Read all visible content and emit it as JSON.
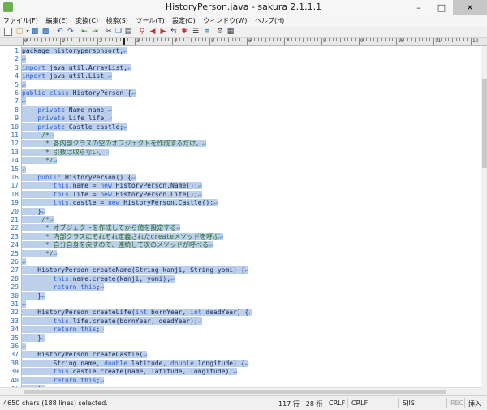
{
  "window": {
    "title": "HistoryPerson.java - sakura 2.1.1.1"
  },
  "menu": [
    "ファイル(F)",
    "編集(E)",
    "変換(C)",
    "検索(S)",
    "ツール(T)",
    "設定(O)",
    "ウィンドウ(W)",
    "ヘルプ(H)"
  ],
  "ruler": {
    "labels": [
      "0",
      "1",
      "2",
      "3",
      "4",
      "5",
      "6",
      "7",
      "8",
      "9",
      "10",
      "11",
      "12",
      "13",
      "14"
    ]
  },
  "lines": [
    {
      "n": "1",
      "segs": [
        [
          "package historypersonsort;",
          "t"
        ],
        [
          "↵",
          "e"
        ]
      ]
    },
    {
      "n": "2",
      "segs": [
        [
          "↵",
          "e"
        ]
      ]
    },
    {
      "n": "3",
      "segs": [
        [
          "import",
          "k"
        ],
        [
          " java.util.ArrayList;",
          "t"
        ],
        [
          "↵",
          "e"
        ]
      ]
    },
    {
      "n": "4",
      "segs": [
        [
          "import",
          "k"
        ],
        [
          " java.util.List;",
          "t"
        ],
        [
          "↵",
          "e"
        ]
      ]
    },
    {
      "n": "5",
      "segs": [
        [
          "↵",
          "e"
        ]
      ]
    },
    {
      "n": "6",
      "segs": [
        [
          "public class",
          "k"
        ],
        [
          " HistoryPerson {",
          "t"
        ],
        [
          "↵",
          "e"
        ]
      ]
    },
    {
      "n": "7",
      "segs": [
        [
          "↵",
          "e"
        ]
      ]
    },
    {
      "n": "8",
      "segs": [
        [
          "    ",
          "t"
        ],
        [
          "private",
          "k"
        ],
        [
          " Name name;",
          "t"
        ],
        [
          "↵",
          "e"
        ]
      ]
    },
    {
      "n": "9",
      "segs": [
        [
          "    ",
          "t"
        ],
        [
          "private",
          "k"
        ],
        [
          " Life life;",
          "t"
        ],
        [
          "↵",
          "e"
        ]
      ]
    },
    {
      "n": "10",
      "segs": [
        [
          "    ",
          "t"
        ],
        [
          "private",
          "k"
        ],
        [
          " Castle castle;",
          "t"
        ],
        [
          "↵",
          "e"
        ]
      ]
    },
    {
      "n": "11",
      "segs": [
        [
          "     /*",
          "c"
        ],
        [
          "↵",
          "e"
        ]
      ]
    },
    {
      "n": "12",
      "segs": [
        [
          "      * 各内部クラスの空のオブジェクトを作成するだけ。",
          "c"
        ],
        [
          "↵",
          "e"
        ]
      ]
    },
    {
      "n": "13",
      "segs": [
        [
          "      * 引数は取らない。",
          "c"
        ],
        [
          "↵",
          "e"
        ]
      ]
    },
    {
      "n": "14",
      "segs": [
        [
          "      */",
          "c"
        ],
        [
          "↵",
          "e"
        ]
      ]
    },
    {
      "n": "15",
      "segs": [
        [
          "↵",
          "e"
        ]
      ]
    },
    {
      "n": "16",
      "segs": [
        [
          "    ",
          "t"
        ],
        [
          "public",
          "k"
        ],
        [
          " HistoryPerson() {",
          "t"
        ],
        [
          "↵",
          "e"
        ]
      ]
    },
    {
      "n": "17",
      "segs": [
        [
          "        ",
          "t"
        ],
        [
          "this",
          "k"
        ],
        [
          ".name = ",
          "t"
        ],
        [
          "new",
          "k"
        ],
        [
          " HistoryPerson.Name();",
          "t"
        ],
        [
          "↵",
          "e"
        ]
      ]
    },
    {
      "n": "18",
      "segs": [
        [
          "        ",
          "t"
        ],
        [
          "this",
          "k"
        ],
        [
          ".life = ",
          "t"
        ],
        [
          "new",
          "k"
        ],
        [
          " HistoryPerson.Life();",
          "t"
        ],
        [
          "↵",
          "e"
        ]
      ]
    },
    {
      "n": "19",
      "segs": [
        [
          "        ",
          "t"
        ],
        [
          "this",
          "k"
        ],
        [
          ".castle = ",
          "t"
        ],
        [
          "new",
          "k"
        ],
        [
          " HistoryPerson.Castle();",
          "t"
        ],
        [
          "↵",
          "e"
        ]
      ]
    },
    {
      "n": "20",
      "segs": [
        [
          "    }",
          "t"
        ],
        [
          "↵",
          "e"
        ]
      ]
    },
    {
      "n": "21",
      "segs": [
        [
          "     /*",
          "c"
        ],
        [
          "↵",
          "e"
        ]
      ]
    },
    {
      "n": "22",
      "segs": [
        [
          "      * オブジェクトを作成してから値を設定する",
          "c"
        ],
        [
          "↵",
          "e"
        ]
      ]
    },
    {
      "n": "23",
      "segs": [
        [
          "      * 内部クラスにそれぞれ定義されたcreateメソッドを呼ぶ",
          "c"
        ],
        [
          "↵",
          "e"
        ]
      ]
    },
    {
      "n": "24",
      "segs": [
        [
          "      * 自分自身を戻すので、連続して次のメソッドが呼べる",
          "c"
        ],
        [
          "↵",
          "e"
        ]
      ]
    },
    {
      "n": "25",
      "segs": [
        [
          "      */",
          "c"
        ],
        [
          "↵",
          "e"
        ]
      ]
    },
    {
      "n": "26",
      "segs": [
        [
          "↵",
          "e"
        ]
      ]
    },
    {
      "n": "27",
      "segs": [
        [
          "    HistoryPerson createName(String kanji, String yomi) {",
          "t"
        ],
        [
          "↵",
          "e"
        ]
      ]
    },
    {
      "n": "28",
      "segs": [
        [
          "        ",
          "t"
        ],
        [
          "this",
          "k"
        ],
        [
          ".name.create(kanji, yomi);",
          "t"
        ],
        [
          "↵",
          "e"
        ]
      ]
    },
    {
      "n": "29",
      "segs": [
        [
          "        ",
          "t"
        ],
        [
          "return this",
          "k"
        ],
        [
          ";",
          "t"
        ],
        [
          "↵",
          "e"
        ]
      ]
    },
    {
      "n": "30",
      "segs": [
        [
          "    }",
          "t"
        ],
        [
          "↵",
          "e"
        ]
      ]
    },
    {
      "n": "31",
      "segs": [
        [
          "↵",
          "e"
        ]
      ]
    },
    {
      "n": "32",
      "segs": [
        [
          "    HistoryPerson createLife(",
          "t"
        ],
        [
          "int",
          "k"
        ],
        [
          " bornYear, ",
          "t"
        ],
        [
          "int",
          "k"
        ],
        [
          " deadYear) {",
          "t"
        ],
        [
          "↵",
          "e"
        ]
      ]
    },
    {
      "n": "33",
      "segs": [
        [
          "        ",
          "t"
        ],
        [
          "this",
          "k"
        ],
        [
          ".life.create(bornYear, deadYear);",
          "t"
        ],
        [
          "↵",
          "e"
        ]
      ]
    },
    {
      "n": "34",
      "segs": [
        [
          "        ",
          "t"
        ],
        [
          "return this",
          "k"
        ],
        [
          ";",
          "t"
        ],
        [
          "↵",
          "e"
        ]
      ]
    },
    {
      "n": "35",
      "segs": [
        [
          "    }",
          "t"
        ],
        [
          "↵",
          "e"
        ]
      ]
    },
    {
      "n": "36",
      "segs": [
        [
          "↵",
          "e"
        ]
      ]
    },
    {
      "n": "37",
      "segs": [
        [
          "    HistoryPerson createCastle(",
          "t"
        ],
        [
          "↵",
          "e"
        ]
      ]
    },
    {
      "n": "38",
      "segs": [
        [
          "        String name, ",
          "t"
        ],
        [
          "double",
          "k"
        ],
        [
          " latitude, ",
          "t"
        ],
        [
          "double",
          "k"
        ],
        [
          " longitude) {",
          "t"
        ],
        [
          "↵",
          "e"
        ]
      ]
    },
    {
      "n": "39",
      "segs": [
        [
          "        ",
          "t"
        ],
        [
          "this",
          "k"
        ],
        [
          ".castle.create(name, latitude, longitude);",
          "t"
        ],
        [
          "↵",
          "e"
        ]
      ]
    },
    {
      "n": "40",
      "segs": [
        [
          "        ",
          "t"
        ],
        [
          "return this",
          "k"
        ],
        [
          ";",
          "t"
        ],
        [
          "↵",
          "e"
        ]
      ]
    },
    {
      "n": "41",
      "segs": [
        [
          "    }",
          "t"
        ],
        [
          "↵",
          "e"
        ]
      ]
    },
    {
      "n": "42",
      "segs": [
        [
          "↵",
          "e"
        ]
      ]
    }
  ],
  "status": {
    "message": "4650 chars (188 lines) selected.",
    "position": "117 行　28 桁",
    "eol1": "CRLF",
    "eol2": "CRLF",
    "encoding": "SJIS",
    "rec": "REC",
    "mode": "挿入"
  },
  "colors": {
    "selection": "#bccfeb",
    "keyword": "#2f5fd0",
    "comment": "#2b6b2b",
    "linenumber": "#1b6fc2"
  }
}
